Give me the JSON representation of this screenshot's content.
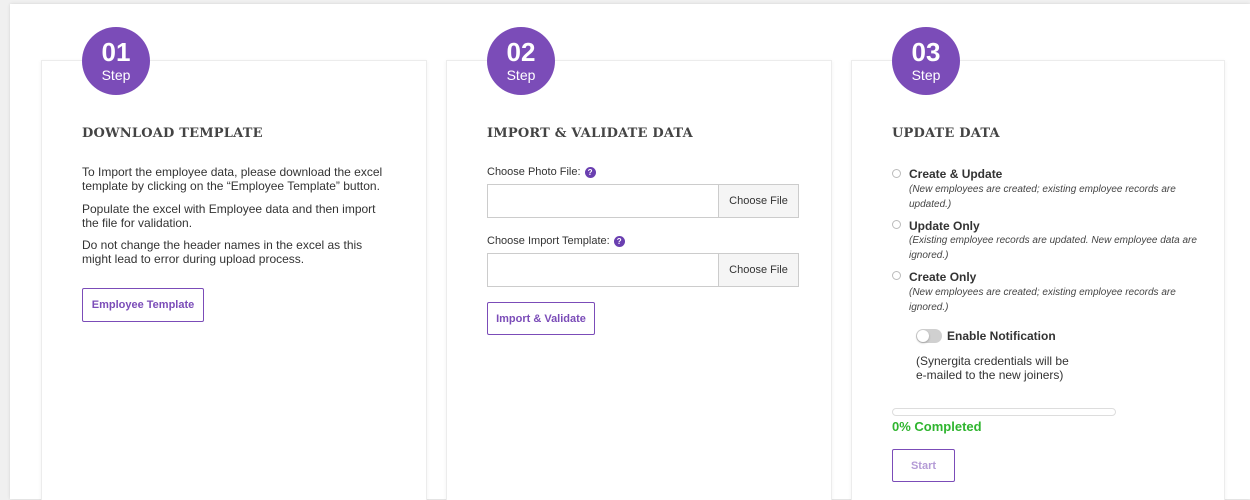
{
  "step_word": "Step",
  "steps": [
    {
      "number": "01",
      "title": "DOWNLOAD TEMPLATE",
      "paragraphs": [
        "To Import the employee data, please download the excel template by clicking on the “Employee Template” button.",
        "Populate the excel with Employee data and then import the file for validation.",
        "Do not change the header names in the excel as this might lead to error during upload process."
      ],
      "button_label": "Employee Template"
    },
    {
      "number": "02",
      "title": "IMPORT & VALIDATE DATA",
      "photo_label": "Choose Photo File:",
      "photo_value": "",
      "template_label": "Choose Import Template:",
      "template_value": "",
      "choose_file_label": "Choose File",
      "help_glyph": "?",
      "button_label": "Import & Validate"
    },
    {
      "number": "03",
      "title": "UPDATE DATA",
      "options": [
        {
          "label": "Create & Update",
          "description": "(New employees are created; existing employee records are updated.)",
          "selected": false
        },
        {
          "label": "Update Only",
          "description": "(Existing employee records are updated. New employee data are ignored.)",
          "selected": false
        },
        {
          "label": "Create Only",
          "description": "(New employees are created; existing employee records are ignored.)",
          "selected": false
        }
      ],
      "notification_label": "Enable Notification",
      "notification_enabled": false,
      "notification_note_line1": "(Synergita credentials will be",
      "notification_note_line2": "e-mailed to the new joiners)",
      "progress_percent": 0,
      "progress_text": "0% Completed",
      "start_label": "Start"
    }
  ],
  "colors": {
    "accent": "#7b4cb8",
    "success": "#2fb52f"
  }
}
